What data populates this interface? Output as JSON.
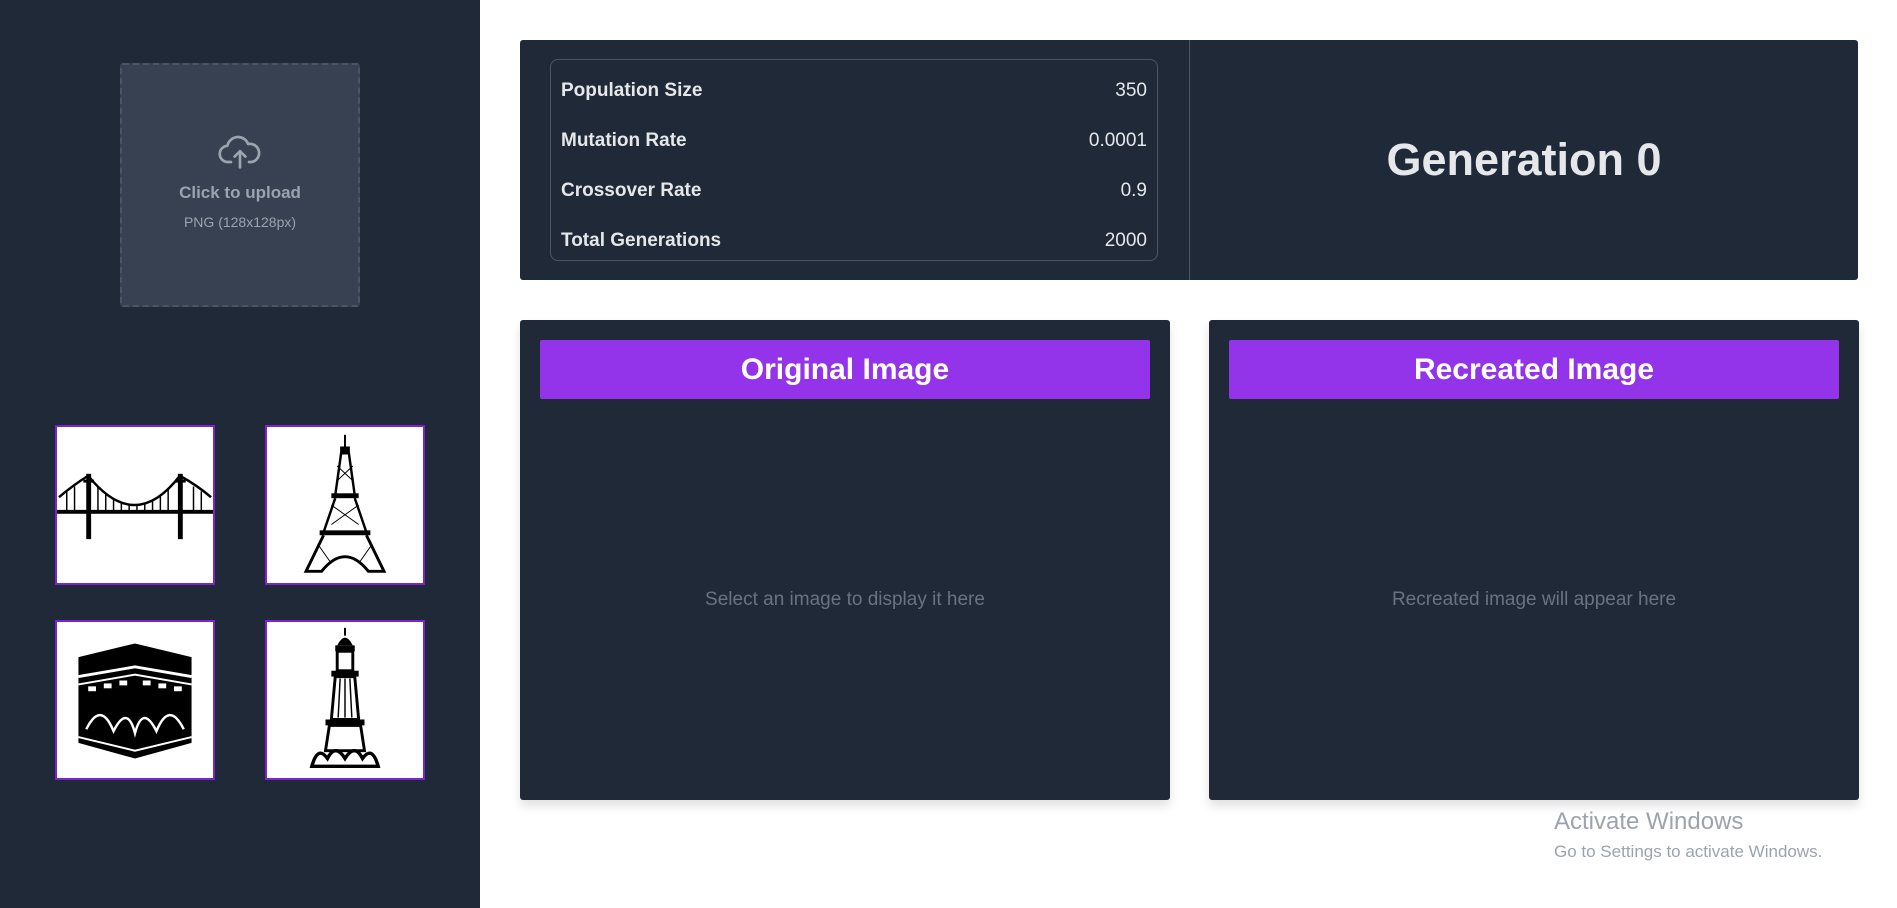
{
  "sidebar": {
    "upload": {
      "label": "Click to upload",
      "hint": "PNG (128x128px)",
      "icon": "cloud-upload-icon"
    },
    "presets": [
      {
        "name": "bridge",
        "icon": "bridge-icon"
      },
      {
        "name": "eiffel-tower",
        "icon": "eiffel-tower-icon"
      },
      {
        "name": "kaaba",
        "icon": "kaaba-icon"
      },
      {
        "name": "minar-tower",
        "icon": "minar-tower-icon"
      }
    ]
  },
  "params": [
    {
      "label": "Population Size",
      "value": "350"
    },
    {
      "label": "Mutation Rate",
      "value": "0.0001"
    },
    {
      "label": "Crossover Rate",
      "value": "0.9"
    },
    {
      "label": "Total Generations",
      "value": "2000"
    }
  ],
  "generation": "Generation 0",
  "panels": {
    "original": {
      "title": "Original Image",
      "placeholder": "Select an image to display it here"
    },
    "recreated": {
      "title": "Recreated Image",
      "placeholder": "Recreated image will appear here"
    }
  },
  "watermark": {
    "title": "Activate Windows",
    "subtitle": "Go to Settings to activate Windows."
  },
  "colors": {
    "sidebar_bg": "#1f2937",
    "panel_bg": "#1f2937",
    "accent": "#9333ea",
    "thumb_border": "#7e22ce"
  }
}
